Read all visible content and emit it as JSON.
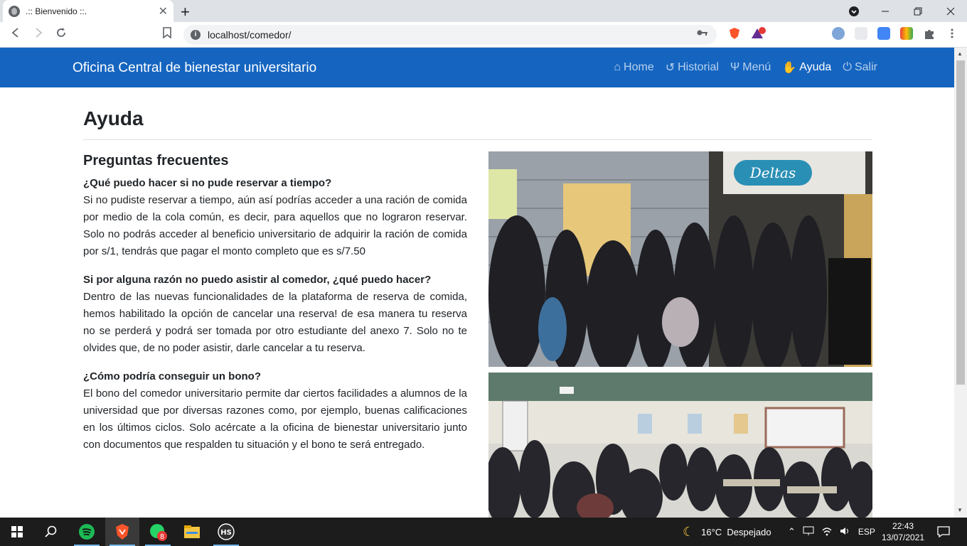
{
  "browser": {
    "tab_title": ".:: Bienvenido ::.",
    "url": "localhost/comedor/",
    "close_glyph": "✕",
    "new_tab_glyph": "+"
  },
  "site": {
    "brand": "Oficina Central de bienestar universitario",
    "nav": [
      {
        "label": "Home",
        "icon": "home-icon",
        "glyph": "⌂"
      },
      {
        "label": "Historial",
        "icon": "history-icon",
        "glyph": "↺"
      },
      {
        "label": "Menú",
        "icon": "utensils-icon",
        "glyph": "Ψ"
      },
      {
        "label": "Ayuda",
        "icon": "hands-helping-icon",
        "glyph": "✋"
      },
      {
        "label": "Salir",
        "icon": "power-icon",
        "glyph": "⏻"
      }
    ]
  },
  "page": {
    "title": "Ayuda",
    "faq_heading": "Preguntas frecuentes",
    "faqs": [
      {
        "question": "¿Qué puedo hacer si no pude reservar a tiempo?",
        "answer": "Si no pudiste reservar a tiempo, aún así podrías acceder a una ración de comida por medio de la cola común, es decir, para aquellos que no lograron reservar. Solo no podrás acceder al beneficio universitario de adquirir la ración de comida por s/1, tendrás que pagar el monto completo que es s/7.50"
      },
      {
        "question": "Si por alguna razón no puedo asistir al comedor, ¿qué puedo hacer?",
        "answer": "Dentro de las nuevas funcionalidades de la plataforma de reserva de comida, hemos habilitado la opción de cancelar una reserva! de esa manera tu reserva no se perderá y podrá ser tomada por otro estudiante del anexo 7. Solo no te olvides que, de no poder asistir, darle cancelar a tu reserva."
      },
      {
        "question": "¿Cómo podría conseguir un bono?",
        "answer": "El bono del comedor universitario permite dar ciertos facilidades a alumnos de la universidad que por diversas razones como, por ejemplo, buenas calificaciones en los últimos ciclos. Solo acércate a la oficina de bienestar universitario junto con documentos que respalden tu situación y el bono te será entregado."
      }
    ],
    "photo1_sign": "Deltas"
  },
  "taskbar": {
    "weather": "16°C  Despejado",
    "lang": "ESP",
    "time": "22:43",
    "date": "13/07/2021",
    "whatsapp_badge": "8",
    "hs_label": "HS"
  },
  "colors": {
    "navbar": "#1565c0",
    "taskbar": "#1c1c1c"
  }
}
